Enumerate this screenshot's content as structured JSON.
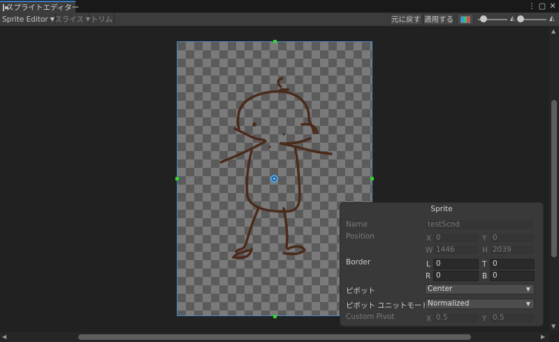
{
  "tab": {
    "title": "スプライトエディター",
    "menu_icon": "kebab-menu-icon",
    "maximize_icon": "maximize-icon",
    "close_icon": "close-icon"
  },
  "toolbar": {
    "sprite_editor_label": "Sprite Editor",
    "slice_label": "スライス",
    "trim_label": "トリム",
    "revert_label": "元に戻す",
    "apply_label": "適用する",
    "color_icon": "color-channels-icon",
    "zoom_level": 0.1,
    "mip_level": 0.0
  },
  "sprite_panel": {
    "title": "Sprite",
    "name_label": "Name",
    "name_value": "testScnd",
    "position_label": "Position",
    "position": {
      "x_label": "X",
      "x": "0",
      "y_label": "Y",
      "y": "0",
      "w_label": "W",
      "w": "1446",
      "h_label": "H",
      "h": "2039"
    },
    "border_label": "Border",
    "border": {
      "l_label": "L",
      "l": "0",
      "t_label": "T",
      "t": "0",
      "r_label": "R",
      "r": "0",
      "b_label": "B",
      "b": "0"
    },
    "pivot_label": "ピボット",
    "pivot_value": "Center",
    "pivot_unit_label": "ピボット ユニットモード",
    "pivot_unit_value": "Normalized",
    "custom_pivot_label": "Custom Pivot",
    "custom_pivot": {
      "x_label": "X",
      "x": "0.5",
      "y_label": "Y",
      "y": "0.5"
    }
  },
  "colors": {
    "accent": "#3a79bb",
    "handle": "#31d431",
    "stroke": "#4a2a1a"
  }
}
